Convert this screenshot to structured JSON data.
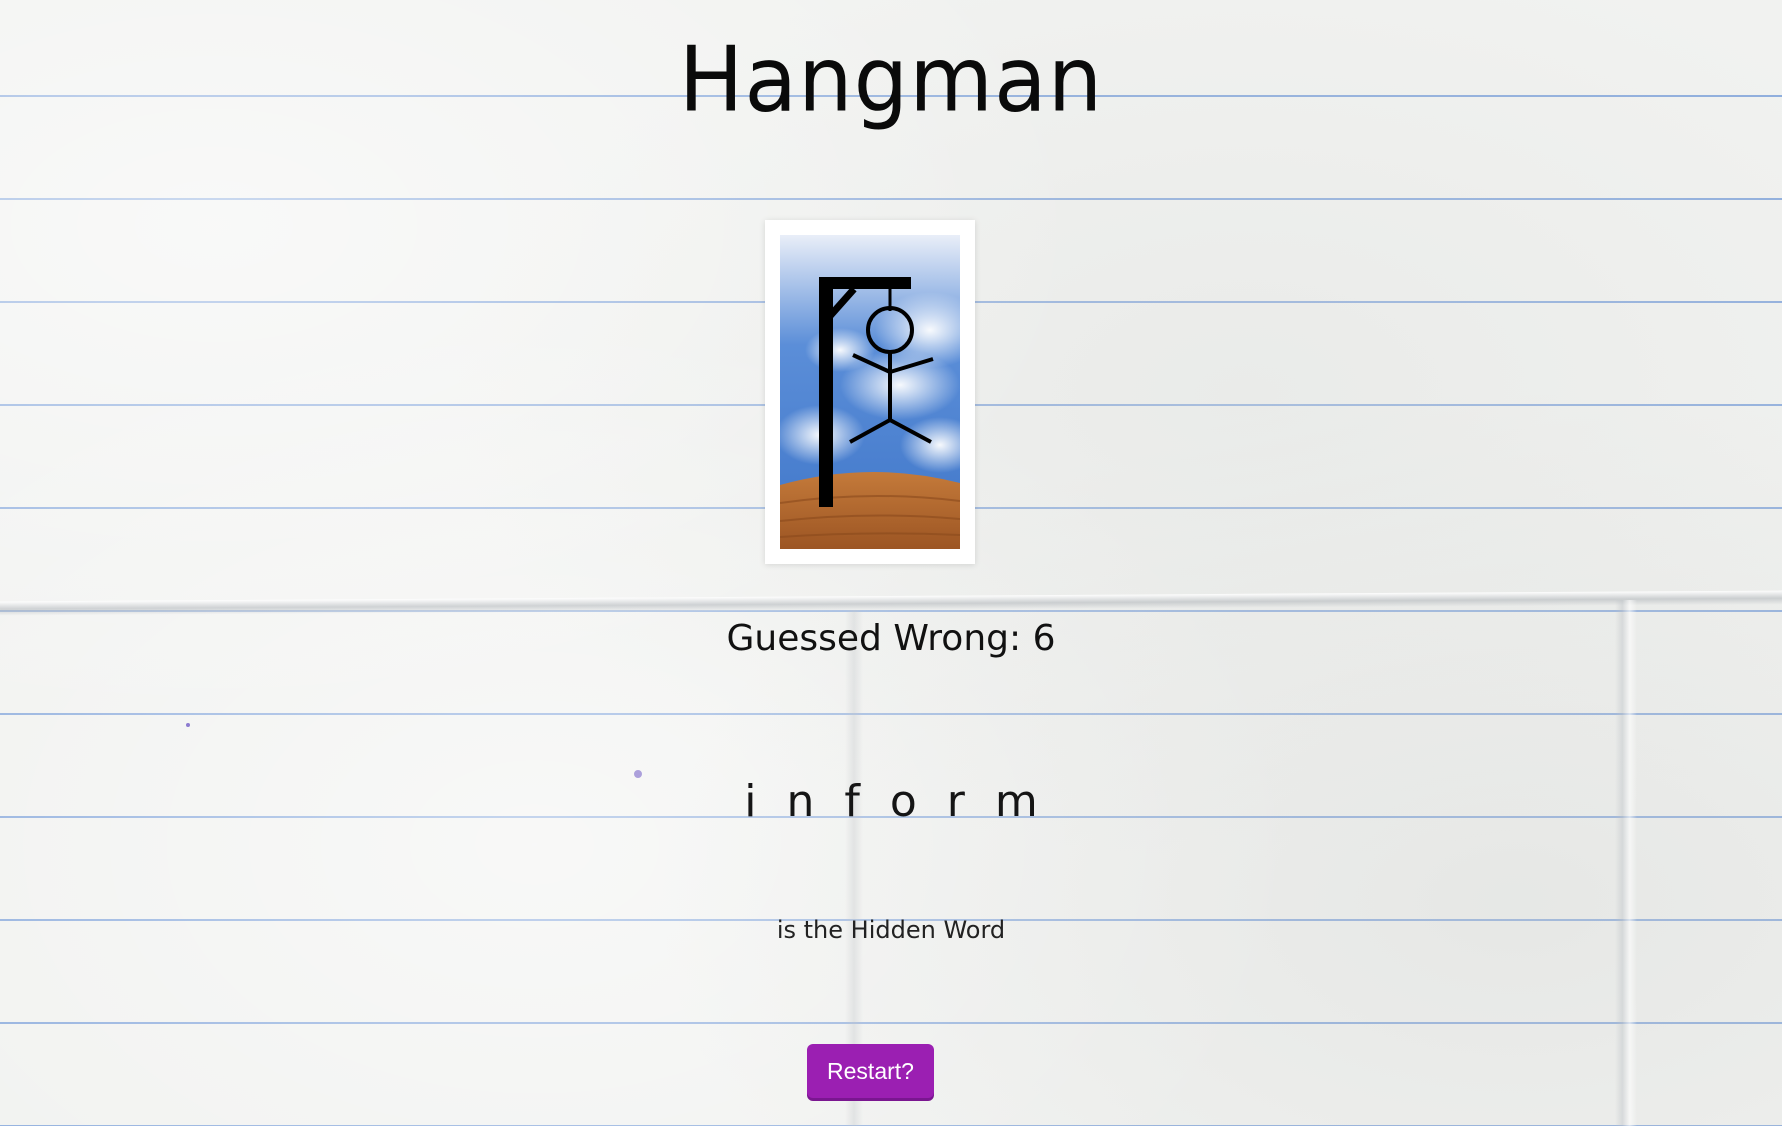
{
  "game": {
    "title": "Hangman",
    "guessed_wrong_label": "Guessed Wrong:",
    "guessed_wrong_count": "6",
    "hidden_word_letters": [
      "i",
      "n",
      "f",
      "o",
      "r",
      "m"
    ],
    "hidden_word_caption": "is the Hidden Word",
    "restart_label": "Restart?"
  },
  "hangman_image": {
    "icon": "hangman-gallows-icon",
    "stage": "6",
    "sky_color": "#5b8ed8",
    "ground_color": "#b86a2d"
  },
  "colors": {
    "restart_button": "#9b1fb2",
    "paper_line": "#6e96d7"
  }
}
